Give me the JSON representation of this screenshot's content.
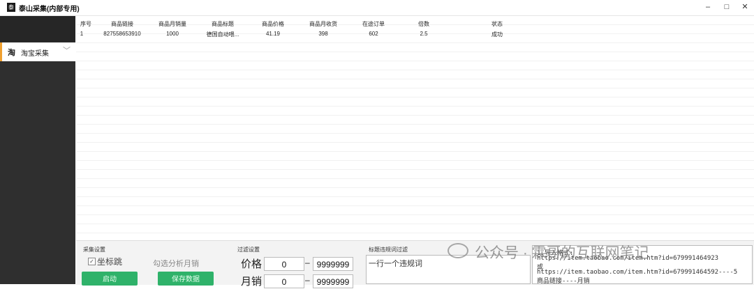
{
  "window": {
    "icon_glyph": "泰",
    "title": "泰山采集(内部专用)",
    "minimize": "–",
    "maximize": "□",
    "close": "✕"
  },
  "sidebar": {
    "items": [
      {
        "icon_glyph": "淘",
        "label": "淘宝采集",
        "chevron": "﹀"
      }
    ]
  },
  "table": {
    "columns": [
      "序号",
      "商品链接",
      "商品月销量",
      "商品标题",
      "商品价格",
      "商品月收货",
      "在途订单",
      "倍数",
      "状态"
    ],
    "rows": [
      [
        "1",
        "827558653910",
        "1000",
        "德国自动喂...",
        "41.19",
        "398",
        "602",
        "2.5",
        "成功"
      ]
    ]
  },
  "collect": {
    "section_label": "采集设置",
    "checkbox_label": "坐标跳",
    "checkbox_mark": "✓",
    "month_sales_label": "勾选分析月销",
    "start_button": "启动",
    "save_button": "保存数据"
  },
  "filter": {
    "section_label": "过滤设置",
    "price_label": "价格",
    "price_min": "0",
    "price_max": "9999999",
    "sales_label": "月销",
    "sales_min": "0",
    "sales_max": "9999999",
    "dash": "–"
  },
  "keywords": {
    "section_label": "标题违规词过滤",
    "placeholder": "一行一个违规词"
  },
  "urls": {
    "lines": [
      "1.导入格式:",
      "https://item.taobao.com/item.htm?id=679991464923",
      "或",
      "https://item.taobao.com/item.htm?id=679991464592----5",
      "商品链接----月销"
    ]
  },
  "watermark": {
    "text": "公众号 · 霖哥的互联网笔记"
  }
}
